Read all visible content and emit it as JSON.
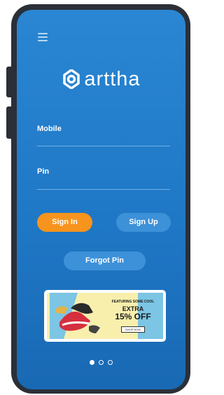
{
  "app": {
    "logo_text": "arttha"
  },
  "form": {
    "mobile_label": "Mobile",
    "mobile_value": "",
    "pin_label": "Pin",
    "pin_value": ""
  },
  "actions": {
    "sign_in_label": "Sign In",
    "sign_up_label": "Sign Up",
    "forgot_pin_label": "Forgot Pin"
  },
  "banner": {
    "headline": "FEATURING SOME COOL",
    "line1": "EXTRA",
    "line2": "15% OFF",
    "cta": "SHOP NOW"
  },
  "carousel": {
    "page_count": 3,
    "active_index": 0
  },
  "colors": {
    "screen_bg": "#2a86d3",
    "primary_button": "#f7941d",
    "secondary_button": "#3d91d8",
    "frame": "#2b2f38"
  },
  "icons": {
    "menu": "hamburger-icon",
    "logo": "arttha-logo-icon"
  }
}
